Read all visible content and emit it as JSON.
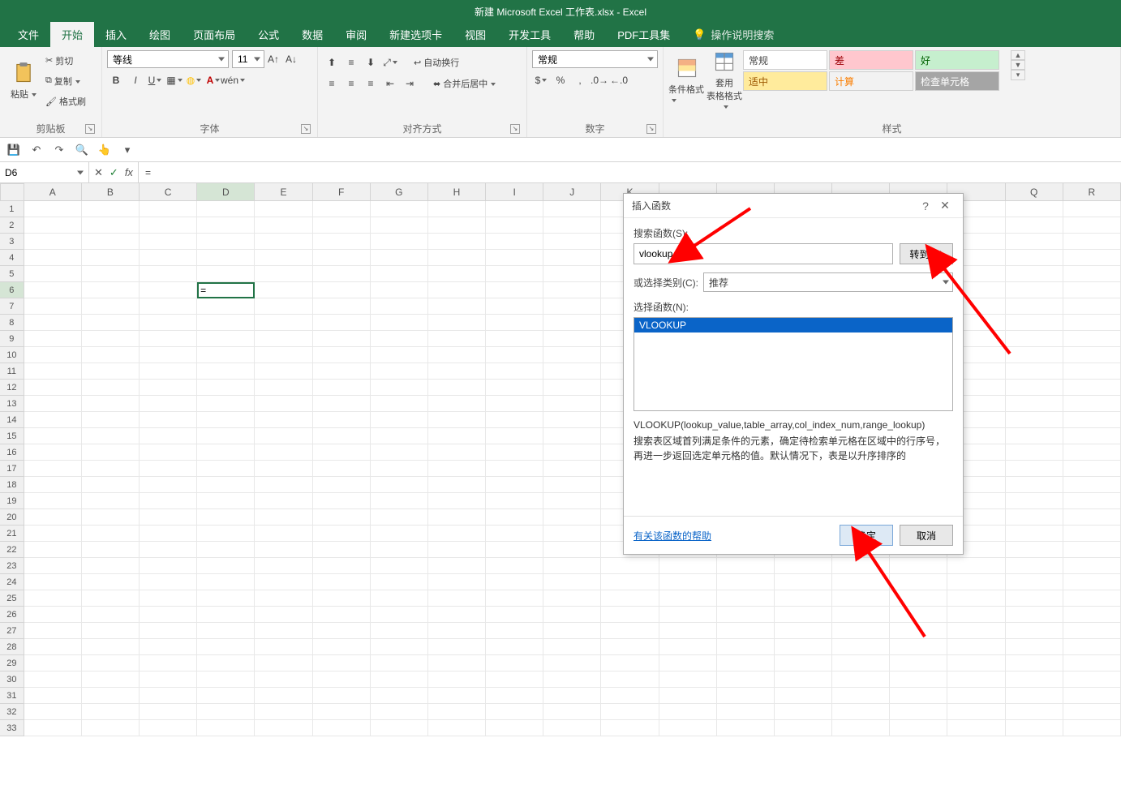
{
  "title": "新建 Microsoft Excel 工作表.xlsx - Excel",
  "tabs": [
    "文件",
    "开始",
    "插入",
    "绘图",
    "页面布局",
    "公式",
    "数据",
    "审阅",
    "新建选项卡",
    "视图",
    "开发工具",
    "帮助",
    "PDF工具集"
  ],
  "active_tab_index": 1,
  "tell_me": "操作说明搜索",
  "clipboard": {
    "paste": "粘贴",
    "cut": "剪切",
    "copy": "复制",
    "format_painter": "格式刷",
    "group": "剪贴板"
  },
  "font": {
    "name": "等线",
    "size": "11",
    "group": "字体"
  },
  "align": {
    "wrap": "自动换行",
    "merge": "合并后居中",
    "group": "对齐方式"
  },
  "number": {
    "format": "常规",
    "group": "数字"
  },
  "styles": {
    "cond": "条件格式",
    "table": "套用\n表格格式",
    "cells": [
      {
        "label": "常规",
        "bg": "#ffffff",
        "fg": "#444444"
      },
      {
        "label": "差",
        "bg": "#ffc7ce",
        "fg": "#9c0006"
      },
      {
        "label": "好",
        "bg": "#c6efce",
        "fg": "#006100"
      },
      {
        "label": "适中",
        "bg": "#ffeb9c",
        "fg": "#9c5700"
      },
      {
        "label": "计算",
        "bg": "#f2f2f2",
        "fg": "#fa7d00"
      },
      {
        "label": "检查单元格",
        "bg": "#a5a5a5",
        "fg": "#ffffff"
      }
    ],
    "group": "样式"
  },
  "name_box": "D6",
  "formula_bar": "=",
  "columns": [
    "A",
    "B",
    "C",
    "D",
    "E",
    "F",
    "G",
    "H",
    "I",
    "J",
    "K",
    "",
    "",
    "",
    "",
    "",
    "",
    "Q",
    "R"
  ],
  "row_count": 33,
  "active_cell": {
    "row": 6,
    "col": "D",
    "display": "="
  },
  "dialog": {
    "title": "插入函数",
    "search_label": "搜索函数(S):",
    "search_value": "vlookup",
    "go": "转到(G)",
    "category_label": "或选择类别(C):",
    "category_value": "推荐",
    "select_label": "选择函数(N):",
    "functions": [
      "VLOOKUP"
    ],
    "selected_index": 0,
    "signature": "VLOOKUP(lookup_value,table_array,col_index_num,range_lookup)",
    "description": "搜索表区域首列满足条件的元素，确定待检索单元格在区域中的行序号，再进一步返回选定单元格的值。默认情况下，表是以升序排序的",
    "help": "有关该函数的帮助",
    "ok": "确定",
    "cancel": "取消"
  }
}
